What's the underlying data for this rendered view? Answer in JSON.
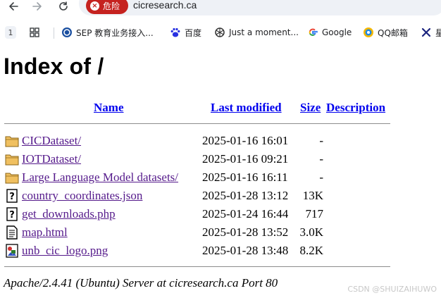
{
  "browser": {
    "security_chip_label": "危险",
    "url": "cicresearch.ca",
    "tab_group_count": "1",
    "bookmarks": [
      {
        "label": "SEP 教育业务接入...",
        "icon": "sep-icon"
      },
      {
        "label": "百度",
        "icon": "baidu-paw-icon"
      },
      {
        "label": "Just a moment...",
        "icon": "openai-icon"
      },
      {
        "label": "Google",
        "icon": "google-g-icon"
      },
      {
        "label": "QQ邮箱",
        "icon": "qq-mail-icon"
      },
      {
        "label": "星",
        "icon": "x-star-icon"
      }
    ]
  },
  "page": {
    "title": "Index of /",
    "headers": {
      "name": "Name",
      "last_modified": "Last modified",
      "size": "Size",
      "description": "Description"
    },
    "entries": [
      {
        "name": "CICDataset/",
        "modified": "2025-01-16 16:01",
        "size": "-",
        "icon": "folder-icon"
      },
      {
        "name": "IOTDataset/",
        "modified": "2025-01-16 09:21",
        "size": "-",
        "icon": "folder-icon"
      },
      {
        "name": "Large Language Model datasets/",
        "modified": "2025-01-16 16:11",
        "size": "-",
        "icon": "folder-icon"
      },
      {
        "name": "country_coordinates.json",
        "modified": "2025-01-28 13:12",
        "size": "13K",
        "icon": "unknown-file-icon"
      },
      {
        "name": "get_downloads.php",
        "modified": "2025-01-24 16:44",
        "size": "717",
        "icon": "unknown-file-icon"
      },
      {
        "name": "map.html",
        "modified": "2025-01-28 13:52",
        "size": "3.0K",
        "icon": "text-file-icon"
      },
      {
        "name": "unb_cic_logo.png",
        "modified": "2025-01-28 13:48",
        "size": "8.2K",
        "icon": "image-file-icon"
      }
    ],
    "server_signature": "Apache/2.4.41 (Ubuntu) Server at cicresearch.ca Port 80"
  },
  "watermark": "CSDN @SHUIZAIHUWO",
  "colors": {
    "link": "#0000ee",
    "visited_link": "#551a8b",
    "danger_chip": "#c5221f",
    "omnibox_bg": "#eef1f6"
  }
}
